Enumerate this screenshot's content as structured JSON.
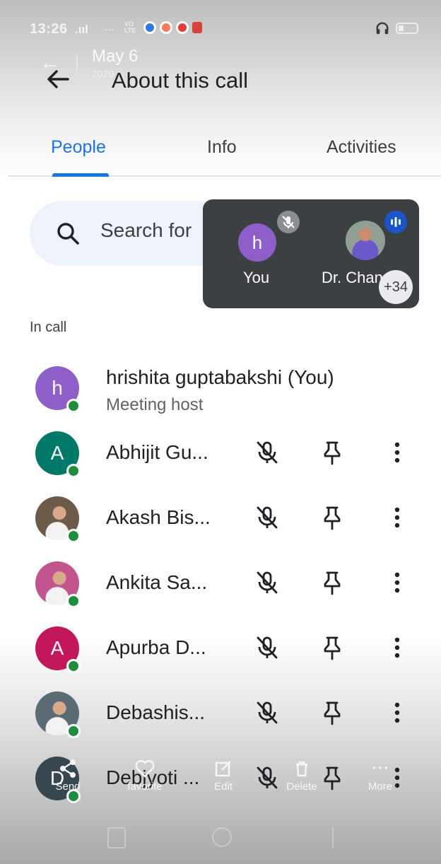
{
  "status": {
    "time": "13:26",
    "signal": ".ııl",
    "net": "...",
    "vo": "VO\nLTE"
  },
  "ghost": {
    "date": "May 6",
    "year": "2020"
  },
  "header": {
    "title": "About this call"
  },
  "tabs": [
    {
      "label": "People",
      "active": true
    },
    {
      "label": "Info",
      "active": false
    },
    {
      "label": "Activities",
      "active": false
    }
  ],
  "search": {
    "placeholder": "Search for"
  },
  "tile": {
    "self_initial": "h",
    "self_name": "You",
    "other_name": "Dr. Chand",
    "more_count": "+34"
  },
  "section": {
    "label": "In call"
  },
  "host": {
    "initial": "h",
    "name": "hrishita guptabakshi (You)",
    "role": "Meeting host"
  },
  "participants": [
    {
      "name": "Abhijit Gu...",
      "initial": "A",
      "color": "#00796b",
      "photo": false
    },
    {
      "name": "Akash Bis...",
      "initial": "",
      "color": "#6d5a48",
      "photo": true
    },
    {
      "name": "Ankita Sa...",
      "initial": "",
      "color": "#c2558e",
      "photo": true
    },
    {
      "name": "Apurba D...",
      "initial": "A",
      "color": "#c2185b",
      "photo": false
    },
    {
      "name": "Debashis...",
      "initial": "",
      "color": "#5b6b73",
      "photo": true
    },
    {
      "name": "Debjyoti ...",
      "initial": "D",
      "color": "#37474f",
      "photo": false
    }
  ],
  "ghost_actions": [
    {
      "label": "Send"
    },
    {
      "label": "favorite"
    },
    {
      "label": "Edit"
    },
    {
      "label": "Delete"
    },
    {
      "label": "More"
    }
  ],
  "colors": {
    "accent": "#1a73e8",
    "presence": "#1e8e3e",
    "host_avatar": "#8e5fc9",
    "panel": "#3c4043"
  }
}
